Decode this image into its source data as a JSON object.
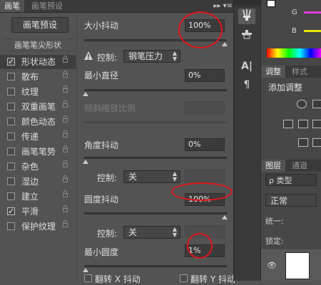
{
  "top_tabs": {
    "brush": "画笔",
    "brush_presets": "画笔预设",
    "menu_glyph": "▸▸ ▾≡"
  },
  "left": {
    "preset_button": "画笔预设",
    "list_header": "画笔笔尖形状",
    "items": [
      {
        "label": "形状动态",
        "checked": true,
        "selected": true
      },
      {
        "label": "散布",
        "checked": false,
        "selected": false
      },
      {
        "label": "纹理",
        "checked": false,
        "selected": false
      },
      {
        "label": "双重画笔",
        "checked": false,
        "selected": false
      },
      {
        "label": "颜色动态",
        "checked": false,
        "selected": false
      },
      {
        "label": "传递",
        "checked": false,
        "selected": false
      },
      {
        "label": "画笔笔势",
        "checked": false,
        "selected": false
      },
      {
        "label": "杂色",
        "checked": false,
        "selected": false
      },
      {
        "label": "湿边",
        "checked": false,
        "selected": false
      },
      {
        "label": "建立",
        "checked": false,
        "selected": false
      },
      {
        "label": "平滑",
        "checked": true,
        "selected": false
      },
      {
        "label": "保护纹理",
        "checked": false,
        "selected": false
      }
    ]
  },
  "content": {
    "size_jitter_label": "大小抖动",
    "size_jitter_value": "100%",
    "control_label": "控制:",
    "control_pen_pressure": "钢笔压力",
    "min_diameter_label": "最小直径",
    "min_diameter_value": "0%",
    "tilt_scale_label": "倾斜缩放比例",
    "angle_jitter_label": "角度抖动",
    "angle_jitter_value": "0%",
    "control_off_1": "关",
    "roundness_jitter_label": "圆度抖动",
    "roundness_jitter_value": "100%",
    "control_off_2": "关",
    "min_roundness_label": "最小圆度",
    "min_roundness_value": "1%",
    "flip_x_label": "翻转 X 抖动",
    "flip_y_label": "翻转 Y 抖动"
  },
  "dock": {
    "g_label": "G",
    "b_label": "B",
    "adjust_tab": "调整",
    "styles_tab": "样式",
    "add_adjust": "添加调整",
    "layers_tab": "图层",
    "channels_tab": "通道",
    "kind_search": "ρ 类型",
    "blend_mode": "正常",
    "unify": "统一:",
    "lock": "锁定:"
  },
  "colors": {
    "accent_red": "#e0161c",
    "g_bar": "#e040e0",
    "b_bar": "#e8e800"
  }
}
